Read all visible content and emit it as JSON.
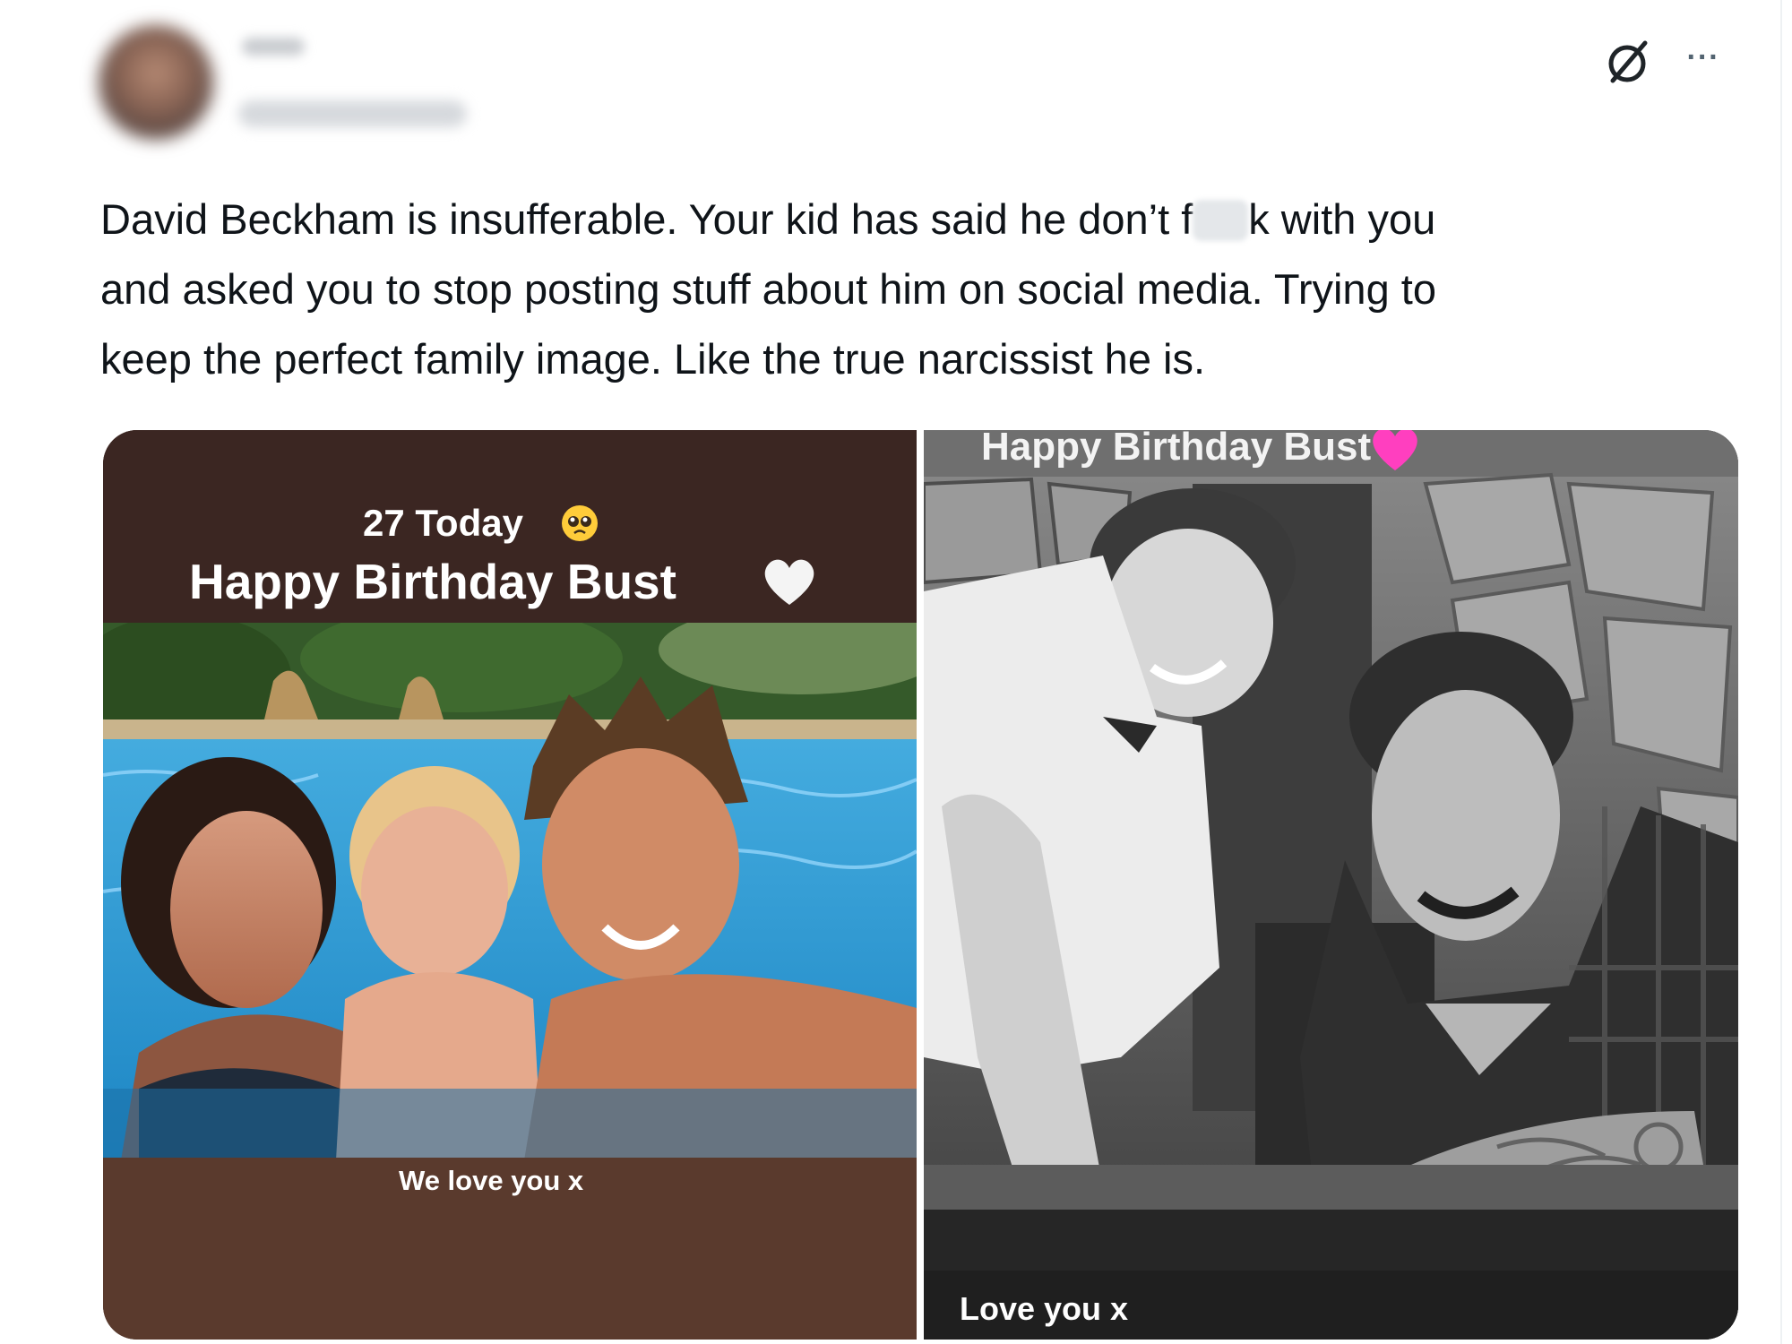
{
  "post": {
    "text_line1_before": "David Beckham is insufferable. Your kid has said he don’t f",
    "text_line1_after": "k with you",
    "text_line2": "and asked you to stop posting stuff about him on social media. Trying to",
    "text_line3": "keep the perfect family image. Like the true narcissist he is."
  },
  "header": {
    "grok_icon": "grok-icon",
    "more_icon": "more-icon",
    "more_symbol": "···"
  },
  "media": {
    "left_story": {
      "age_text": "27 Today",
      "age_emoji": "pleading-face-emoji",
      "birthday_text": "Happy Birthday Bust",
      "birthday_emoji": "white-heart-emoji",
      "caption": "We love you x"
    },
    "right_story": {
      "birthday_text": "Happy Birthday Bust",
      "birthday_emoji": "pink-heart-emoji",
      "caption": "Love you x"
    }
  },
  "colors": {
    "text": "#0f1419",
    "icon_gray": "#536471",
    "story_brown_dark": "#3b2622",
    "story_brown_light": "#5a3a2d",
    "pink_heart": "#ff3fbf"
  }
}
